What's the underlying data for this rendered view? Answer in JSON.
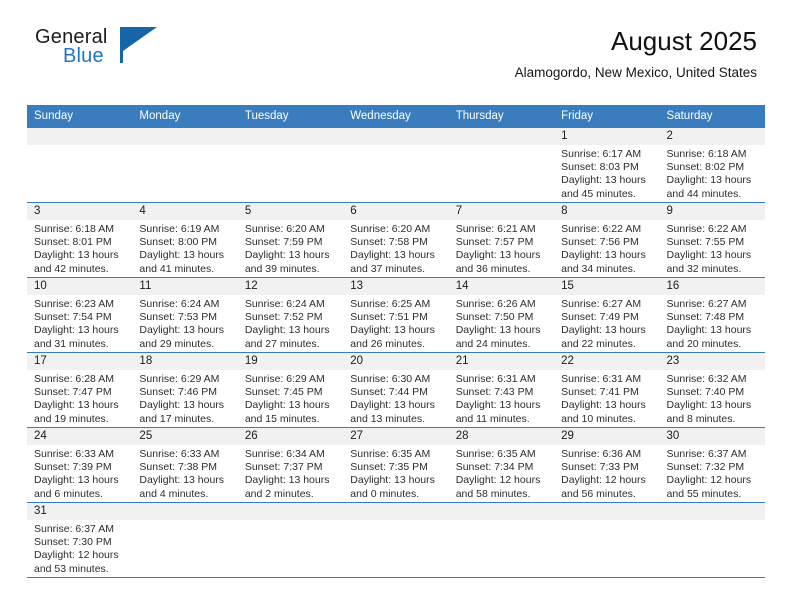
{
  "brand": {
    "name_top": "General",
    "name_bottom": "Blue",
    "accent_color": "#1565a8"
  },
  "header": {
    "title": "August 2025",
    "subtitle": "Alamogordo, New Mexico, United States"
  },
  "calendar": {
    "header_bg": "#3a7dbf",
    "daynum_bg": "#f1f1f1",
    "weekday_names": [
      "Sunday",
      "Monday",
      "Tuesday",
      "Wednesday",
      "Thursday",
      "Friday",
      "Saturday"
    ],
    "labels": {
      "sunrise": "Sunrise:",
      "sunset": "Sunset:",
      "daylight": "Daylight:"
    },
    "weeks": [
      [
        {
          "day": "",
          "blank": true
        },
        {
          "day": "",
          "blank": true
        },
        {
          "day": "",
          "blank": true
        },
        {
          "day": "",
          "blank": true
        },
        {
          "day": "",
          "blank": true
        },
        {
          "day": "1",
          "sunrise": "Sunrise: 6:17 AM",
          "sunset": "Sunset: 8:03 PM",
          "daylight_1": "Daylight: 13 hours",
          "daylight_2": "and 45 minutes."
        },
        {
          "day": "2",
          "sunrise": "Sunrise: 6:18 AM",
          "sunset": "Sunset: 8:02 PM",
          "daylight_1": "Daylight: 13 hours",
          "daylight_2": "and 44 minutes."
        }
      ],
      [
        {
          "day": "3",
          "sunrise": "Sunrise: 6:18 AM",
          "sunset": "Sunset: 8:01 PM",
          "daylight_1": "Daylight: 13 hours",
          "daylight_2": "and 42 minutes."
        },
        {
          "day": "4",
          "sunrise": "Sunrise: 6:19 AM",
          "sunset": "Sunset: 8:00 PM",
          "daylight_1": "Daylight: 13 hours",
          "daylight_2": "and 41 minutes."
        },
        {
          "day": "5",
          "sunrise": "Sunrise: 6:20 AM",
          "sunset": "Sunset: 7:59 PM",
          "daylight_1": "Daylight: 13 hours",
          "daylight_2": "and 39 minutes."
        },
        {
          "day": "6",
          "sunrise": "Sunrise: 6:20 AM",
          "sunset": "Sunset: 7:58 PM",
          "daylight_1": "Daylight: 13 hours",
          "daylight_2": "and 37 minutes."
        },
        {
          "day": "7",
          "sunrise": "Sunrise: 6:21 AM",
          "sunset": "Sunset: 7:57 PM",
          "daylight_1": "Daylight: 13 hours",
          "daylight_2": "and 36 minutes."
        },
        {
          "day": "8",
          "sunrise": "Sunrise: 6:22 AM",
          "sunset": "Sunset: 7:56 PM",
          "daylight_1": "Daylight: 13 hours",
          "daylight_2": "and 34 minutes."
        },
        {
          "day": "9",
          "sunrise": "Sunrise: 6:22 AM",
          "sunset": "Sunset: 7:55 PM",
          "daylight_1": "Daylight: 13 hours",
          "daylight_2": "and 32 minutes."
        }
      ],
      [
        {
          "day": "10",
          "sunrise": "Sunrise: 6:23 AM",
          "sunset": "Sunset: 7:54 PM",
          "daylight_1": "Daylight: 13 hours",
          "daylight_2": "and 31 minutes."
        },
        {
          "day": "11",
          "sunrise": "Sunrise: 6:24 AM",
          "sunset": "Sunset: 7:53 PM",
          "daylight_1": "Daylight: 13 hours",
          "daylight_2": "and 29 minutes."
        },
        {
          "day": "12",
          "sunrise": "Sunrise: 6:24 AM",
          "sunset": "Sunset: 7:52 PM",
          "daylight_1": "Daylight: 13 hours",
          "daylight_2": "and 27 minutes."
        },
        {
          "day": "13",
          "sunrise": "Sunrise: 6:25 AM",
          "sunset": "Sunset: 7:51 PM",
          "daylight_1": "Daylight: 13 hours",
          "daylight_2": "and 26 minutes."
        },
        {
          "day": "14",
          "sunrise": "Sunrise: 6:26 AM",
          "sunset": "Sunset: 7:50 PM",
          "daylight_1": "Daylight: 13 hours",
          "daylight_2": "and 24 minutes."
        },
        {
          "day": "15",
          "sunrise": "Sunrise: 6:27 AM",
          "sunset": "Sunset: 7:49 PM",
          "daylight_1": "Daylight: 13 hours",
          "daylight_2": "and 22 minutes."
        },
        {
          "day": "16",
          "sunrise": "Sunrise: 6:27 AM",
          "sunset": "Sunset: 7:48 PM",
          "daylight_1": "Daylight: 13 hours",
          "daylight_2": "and 20 minutes."
        }
      ],
      [
        {
          "day": "17",
          "sunrise": "Sunrise: 6:28 AM",
          "sunset": "Sunset: 7:47 PM",
          "daylight_1": "Daylight: 13 hours",
          "daylight_2": "and 19 minutes."
        },
        {
          "day": "18",
          "sunrise": "Sunrise: 6:29 AM",
          "sunset": "Sunset: 7:46 PM",
          "daylight_1": "Daylight: 13 hours",
          "daylight_2": "and 17 minutes."
        },
        {
          "day": "19",
          "sunrise": "Sunrise: 6:29 AM",
          "sunset": "Sunset: 7:45 PM",
          "daylight_1": "Daylight: 13 hours",
          "daylight_2": "and 15 minutes."
        },
        {
          "day": "20",
          "sunrise": "Sunrise: 6:30 AM",
          "sunset": "Sunset: 7:44 PM",
          "daylight_1": "Daylight: 13 hours",
          "daylight_2": "and 13 minutes."
        },
        {
          "day": "21",
          "sunrise": "Sunrise: 6:31 AM",
          "sunset": "Sunset: 7:43 PM",
          "daylight_1": "Daylight: 13 hours",
          "daylight_2": "and 11 minutes."
        },
        {
          "day": "22",
          "sunrise": "Sunrise: 6:31 AM",
          "sunset": "Sunset: 7:41 PM",
          "daylight_1": "Daylight: 13 hours",
          "daylight_2": "and 10 minutes."
        },
        {
          "day": "23",
          "sunrise": "Sunrise: 6:32 AM",
          "sunset": "Sunset: 7:40 PM",
          "daylight_1": "Daylight: 13 hours",
          "daylight_2": "and 8 minutes."
        }
      ],
      [
        {
          "day": "24",
          "sunrise": "Sunrise: 6:33 AM",
          "sunset": "Sunset: 7:39 PM",
          "daylight_1": "Daylight: 13 hours",
          "daylight_2": "and 6 minutes."
        },
        {
          "day": "25",
          "sunrise": "Sunrise: 6:33 AM",
          "sunset": "Sunset: 7:38 PM",
          "daylight_1": "Daylight: 13 hours",
          "daylight_2": "and 4 minutes."
        },
        {
          "day": "26",
          "sunrise": "Sunrise: 6:34 AM",
          "sunset": "Sunset: 7:37 PM",
          "daylight_1": "Daylight: 13 hours",
          "daylight_2": "and 2 minutes."
        },
        {
          "day": "27",
          "sunrise": "Sunrise: 6:35 AM",
          "sunset": "Sunset: 7:35 PM",
          "daylight_1": "Daylight: 13 hours",
          "daylight_2": "and 0 minutes."
        },
        {
          "day": "28",
          "sunrise": "Sunrise: 6:35 AM",
          "sunset": "Sunset: 7:34 PM",
          "daylight_1": "Daylight: 12 hours",
          "daylight_2": "and 58 minutes."
        },
        {
          "day": "29",
          "sunrise": "Sunrise: 6:36 AM",
          "sunset": "Sunset: 7:33 PM",
          "daylight_1": "Daylight: 12 hours",
          "daylight_2": "and 56 minutes."
        },
        {
          "day": "30",
          "sunrise": "Sunrise: 6:37 AM",
          "sunset": "Sunset: 7:32 PM",
          "daylight_1": "Daylight: 12 hours",
          "daylight_2": "and 55 minutes."
        }
      ],
      [
        {
          "day": "31",
          "sunrise": "Sunrise: 6:37 AM",
          "sunset": "Sunset: 7:30 PM",
          "daylight_1": "Daylight: 12 hours",
          "daylight_2": "and 53 minutes."
        },
        {
          "day": "",
          "blank": true
        },
        {
          "day": "",
          "blank": true
        },
        {
          "day": "",
          "blank": true
        },
        {
          "day": "",
          "blank": true
        },
        {
          "day": "",
          "blank": true
        },
        {
          "day": "",
          "blank": true
        }
      ]
    ]
  }
}
